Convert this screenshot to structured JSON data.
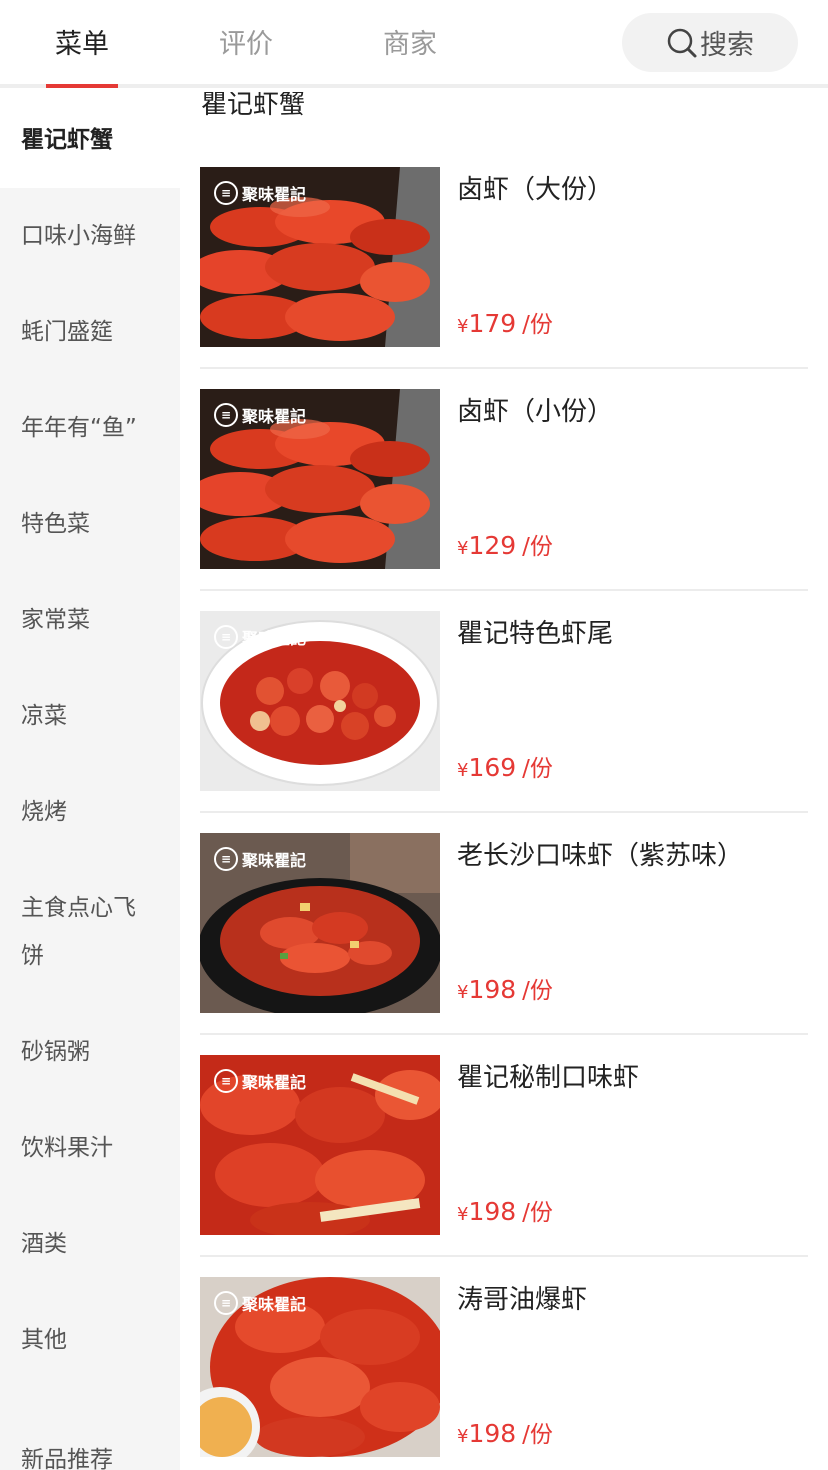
{
  "tabs": {
    "menu": "菜单",
    "review": "评价",
    "shop": "商家",
    "search": "搜索"
  },
  "colors": {
    "accent": "#e53935",
    "sidebar_bg": "#f5f5f5"
  },
  "sidebar": {
    "items": [
      {
        "label": "瞿记虾蟹"
      },
      {
        "label": "口味小海鲜"
      },
      {
        "label": "蚝门盛筵"
      },
      {
        "label": "年年有“鱼”"
      },
      {
        "label": "特色菜"
      },
      {
        "label": "家常菜"
      },
      {
        "label": "凉菜"
      },
      {
        "label": "烧烤"
      },
      {
        "label": "主食点心飞饼"
      },
      {
        "label": "砂锅粥"
      },
      {
        "label": "饮料果汁"
      },
      {
        "label": "酒类"
      },
      {
        "label": "其他"
      },
      {
        "label": "新品推荐"
      }
    ]
  },
  "main": {
    "section_title": "瞿记虾蟹",
    "logo_text": "聚味瞿記",
    "items": [
      {
        "name": "卤虾（大份）",
        "currency": "¥",
        "price": "179",
        "unit": "/份",
        "icon": "crawfish-tray-photo"
      },
      {
        "name": "卤虾（小份）",
        "currency": "¥",
        "price": "129",
        "unit": "/份",
        "icon": "crawfish-tray-photo"
      },
      {
        "name": "瞿记特色虾尾",
        "currency": "¥",
        "price": "169",
        "unit": "/份",
        "icon": "crawfish-tails-plate-photo"
      },
      {
        "name": "老长沙口味虾（紫苏味）",
        "currency": "¥",
        "price": "198",
        "unit": "/份",
        "icon": "crawfish-bowl-photo"
      },
      {
        "name": "瞿记秘制口味虾",
        "currency": "¥",
        "price": "198",
        "unit": "/份",
        "icon": "crawfish-closeup-photo"
      },
      {
        "name": "涛哥油爆虾",
        "currency": "¥",
        "price": "198",
        "unit": "/份",
        "icon": "crawfish-sauce-photo"
      }
    ]
  }
}
